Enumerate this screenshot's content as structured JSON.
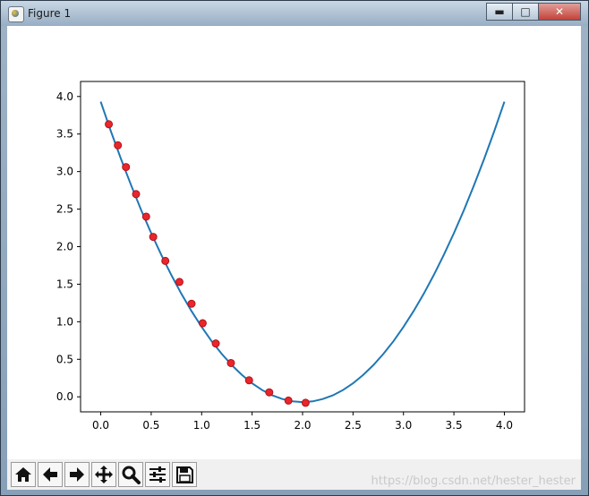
{
  "window": {
    "title": "Figure 1",
    "buttons": {
      "minimize": "▬",
      "maximize": "□",
      "close": "✕"
    }
  },
  "toolbar": {
    "items": [
      "home-icon",
      "back-arrow-icon",
      "forward-arrow-icon",
      "pan-icon",
      "zoom-icon",
      "configure-subplots-icon",
      "save-icon"
    ]
  },
  "watermark": "https://blog.csdn.net/hester_hester",
  "colors": {
    "curve": "#1f77b4",
    "points": "#e8262b",
    "axes": "#000000"
  },
  "chart_data": {
    "type": "line",
    "title": "",
    "xlabel": "",
    "ylabel": "",
    "xlim": [
      -0.2,
      4.2
    ],
    "ylim": [
      -0.2,
      4.2
    ],
    "x_ticks": [
      "0.0",
      "0.5",
      "1.0",
      "1.5",
      "2.0",
      "2.5",
      "3.0",
      "3.5",
      "4.0"
    ],
    "y_ticks": [
      "0.0",
      "0.5",
      "1.0",
      "1.5",
      "2.0",
      "2.5",
      "3.0",
      "3.5",
      "4.0"
    ],
    "grid": false,
    "legend": "none",
    "series": [
      {
        "kind": "line",
        "color": "#1f77b4",
        "x": [
          0.0,
          0.1,
          0.2,
          0.3,
          0.4,
          0.5,
          0.6,
          0.7,
          0.8,
          0.9,
          1.0,
          1.1,
          1.2,
          1.3,
          1.4,
          1.5,
          1.6,
          1.7,
          1.8,
          1.9,
          2.0,
          2.1,
          2.2,
          2.3,
          2.4,
          2.5,
          2.6,
          2.7,
          2.8,
          2.9,
          3.0,
          3.1,
          3.2,
          3.3,
          3.4,
          3.5,
          3.6,
          3.7,
          3.8,
          3.9,
          4.0
        ],
        "y": [
          3.93,
          3.54,
          3.17,
          2.82,
          2.49,
          2.18,
          1.89,
          1.62,
          1.37,
          1.14,
          0.93,
          0.74,
          0.57,
          0.42,
          0.29,
          0.18,
          0.09,
          0.02,
          -0.03,
          -0.06,
          -0.07,
          -0.06,
          -0.03,
          0.02,
          0.09,
          0.18,
          0.29,
          0.42,
          0.57,
          0.74,
          0.93,
          1.14,
          1.37,
          1.62,
          1.89,
          2.18,
          2.49,
          2.82,
          3.17,
          3.54,
          3.93
        ]
      },
      {
        "kind": "scatter",
        "color": "#e8262b",
        "x": [
          0.08,
          0.17,
          0.25,
          0.35,
          0.45,
          0.52,
          0.64,
          0.78,
          0.9,
          1.01,
          1.14,
          1.29,
          1.47,
          1.67,
          1.86,
          2.03
        ],
        "y": [
          3.63,
          3.35,
          3.06,
          2.7,
          2.4,
          2.13,
          1.81,
          1.53,
          1.24,
          0.98,
          0.71,
          0.45,
          0.22,
          0.06,
          -0.05,
          -0.08
        ]
      }
    ]
  }
}
